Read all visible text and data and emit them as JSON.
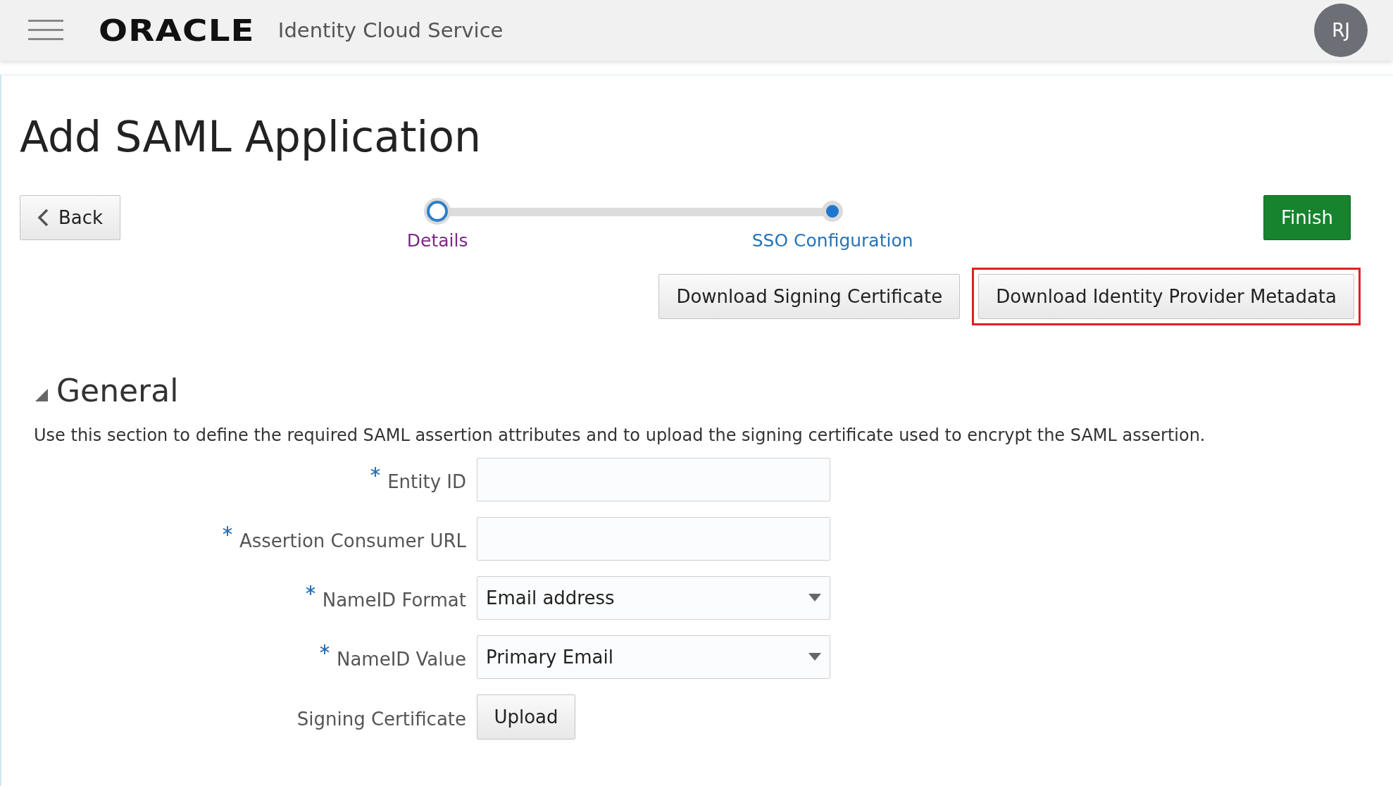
{
  "header": {
    "logo": "ORACLE",
    "product": "Identity Cloud Service",
    "avatar": "RJ"
  },
  "page": {
    "title": "Add SAML Application"
  },
  "nav": {
    "back": "Back",
    "finish": "Finish"
  },
  "steps": [
    {
      "label": "Details",
      "selected": false
    },
    {
      "label": "SSO Configuration",
      "selected": true
    }
  ],
  "actions": [
    {
      "label": "Download Signing Certificate",
      "highlighted": false
    },
    {
      "label": "Download Identity Provider Metadata",
      "highlighted": true
    }
  ],
  "section": {
    "title": "General",
    "expanded": true,
    "description": "Use this section to define the required SAML assertion attributes and to upload the signing certificate used to encrypt the SAML assertion."
  },
  "fields": [
    {
      "kind": "text",
      "label": "Entity ID",
      "required": true
    },
    {
      "kind": "text",
      "label": "Assertion Consumer URL",
      "required": true
    },
    {
      "kind": "select",
      "label": "NameID Format",
      "required": true,
      "value": "Email address"
    },
    {
      "kind": "select",
      "label": "NameID Value",
      "required": true,
      "value": "Primary Email"
    },
    {
      "kind": "upload",
      "label": "Signing Certificate",
      "required": false,
      "button": "Upload"
    }
  ]
}
